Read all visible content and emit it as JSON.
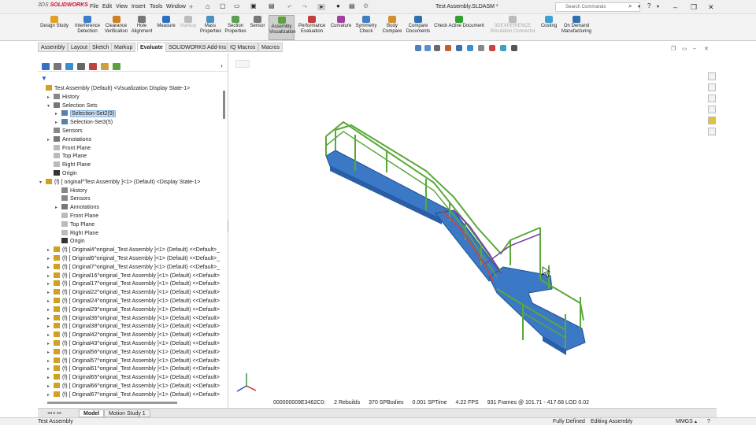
{
  "app": {
    "logo_brand": "3DS",
    "logo_name": "SOLIDWORKS",
    "title": "Test Assembly.SLDASM *",
    "search_placeholder": "Search Commands"
  },
  "menus": [
    "File",
    "Edit",
    "View",
    "Insert",
    "Tools",
    "Window"
  ],
  "ribbon": [
    {
      "label": "Design Study",
      "icon": "design-study-icon",
      "color": "#e0a020"
    },
    {
      "label": "Interference Detection",
      "icon": "interference-icon",
      "color": "#3a7fd0"
    },
    {
      "label": "Clearance Verification",
      "icon": "clearance-icon",
      "color": "#d08020"
    },
    {
      "label": "Hole Alignment",
      "icon": "hole-icon",
      "color": "#777777"
    },
    {
      "label": "Measure",
      "icon": "ruler-icon",
      "color": "#2a70c8"
    },
    {
      "label": "Markup",
      "icon": "markup-icon",
      "color": "#bbbbbb"
    },
    {
      "label": "Mass Properties",
      "icon": "mass-icon",
      "color": "#4a90c0"
    },
    {
      "label": "Section Properties",
      "icon": "section-icon",
      "color": "#5aa050"
    },
    {
      "label": "Sensor",
      "icon": "sensor-icon",
      "color": "#777777"
    },
    {
      "label": "Assembly Visualization",
      "icon": "assembly-viz-icon",
      "color": "#60a040"
    },
    {
      "label": "Performance Evaluation",
      "icon": "performance-icon",
      "color": "#c04040"
    },
    {
      "label": "Curvature",
      "icon": "curvature-icon",
      "color": "#a040a0"
    },
    {
      "label": "Symmetry Check",
      "icon": "symmetry-icon",
      "color": "#4080c0"
    },
    {
      "label": "Body Compare",
      "icon": "body-compare-icon",
      "color": "#d09030"
    },
    {
      "label": "Compare Documents",
      "icon": "compare-docs-icon",
      "color": "#3070b0"
    },
    {
      "label": "Check Active Document",
      "icon": "check-doc-icon",
      "color": "#30a030"
    },
    {
      "label": "3DEXPERIENCE Simulation Connector",
      "icon": "sim-connector-icon",
      "color": "#bbbbbb"
    },
    {
      "label": "Costing",
      "icon": "costing-icon",
      "color": "#40a0d0"
    },
    {
      "label": "On Demand Manufacturing",
      "icon": "manufacturing-icon",
      "color": "#3070b0"
    }
  ],
  "command_tabs": [
    "Assembly",
    "Layout",
    "Sketch",
    "Markup",
    "Evaluate",
    "SOLIDWORKS Add-Ins",
    "IQ Macros",
    "Macros"
  ],
  "active_command_tab": "Evaluate",
  "tree": [
    {
      "label": "Test Assembly (Default) <Visualization Display State-1>",
      "level": 0,
      "toggle": "",
      "icon": "assembly-icon"
    },
    {
      "label": "History",
      "level": 1,
      "toggle": "▸",
      "icon": "history-icon"
    },
    {
      "label": "Selection Sets",
      "level": 1,
      "toggle": "▾",
      "icon": "selection-sets-icon"
    },
    {
      "label": "Selection-Set2(9)",
      "level": 2,
      "toggle": "▸",
      "icon": "selection-set-icon",
      "selected": true
    },
    {
      "label": "Selection-Set3(5)",
      "level": 2,
      "toggle": "▸",
      "icon": "selection-set-icon"
    },
    {
      "label": "Sensors",
      "level": 1,
      "toggle": "",
      "icon": "sensor-folder-icon"
    },
    {
      "label": "Annotations",
      "level": 1,
      "toggle": "▸",
      "icon": "annotations-icon"
    },
    {
      "label": "Front Plane",
      "level": 1,
      "toggle": "",
      "icon": "plane-icon"
    },
    {
      "label": "Top Plane",
      "level": 1,
      "toggle": "",
      "icon": "plane-icon"
    },
    {
      "label": "Right Plane",
      "level": 1,
      "toggle": "",
      "icon": "plane-icon"
    },
    {
      "label": "Origin",
      "level": 1,
      "toggle": "",
      "icon": "origin-icon"
    },
    {
      "label": "(f) [ original^Test Assembly ]<1> (Default) <Display State-1>",
      "level": 0,
      "toggle": "▾",
      "icon": "subassembly-icon"
    },
    {
      "label": "History",
      "level": 2,
      "toggle": "",
      "icon": "history-icon"
    },
    {
      "label": "Sensors",
      "level": 2,
      "toggle": "",
      "icon": "sensor-folder-icon"
    },
    {
      "label": "Annotations",
      "level": 2,
      "toggle": "▸",
      "icon": "annotations-icon"
    },
    {
      "label": "Front Plane",
      "level": 2,
      "toggle": "",
      "icon": "plane-icon"
    },
    {
      "label": "Top Plane",
      "level": 2,
      "toggle": "",
      "icon": "plane-icon"
    },
    {
      "label": "Right Plane",
      "level": 2,
      "toggle": "",
      "icon": "plane-icon"
    },
    {
      "label": "Origin",
      "level": 2,
      "toggle": "",
      "icon": "origin-icon"
    },
    {
      "label": "(f) [ Original4^original_Test Assembly ]<1> (Default) <<Default>_",
      "level": 1,
      "toggle": "▸",
      "icon": "subassembly-icon"
    },
    {
      "label": "(f) [ Original6^original_Test Assembly ]<1> (Default) <<Default>_",
      "level": 1,
      "toggle": "▸",
      "icon": "subassembly-icon"
    },
    {
      "label": "(f) [ Original7^original_Test Assembly ]<1> (Default) <<Default>_",
      "level": 1,
      "toggle": "▸",
      "icon": "subassembly-icon"
    },
    {
      "label": "(f) [ Original16^original_Test Assembly ]<1> (Default) <<Default>",
      "level": 1,
      "toggle": "▸",
      "icon": "subassembly-icon"
    },
    {
      "label": "(f) [ Original17^original_Test Assembly ]<1> (Default) <<Default>",
      "level": 1,
      "toggle": "▸",
      "icon": "subassembly-icon"
    },
    {
      "label": "(f) [ Original22^original_Test Assembly ]<1> (Default) <<Default>",
      "level": 1,
      "toggle": "▸",
      "icon": "subassembly-icon"
    },
    {
      "label": "(f) [ Original24^original_Test Assembly ]<1> (Default) <<Default>",
      "level": 1,
      "toggle": "▸",
      "icon": "subassembly-icon"
    },
    {
      "label": "(f) [ Original29^original_Test Assembly ]<1> (Default) <<Default>",
      "level": 1,
      "toggle": "▸",
      "icon": "subassembly-icon"
    },
    {
      "label": "(f) [ Original36^original_Test Assembly ]<1> (Default) <<Default>",
      "level": 1,
      "toggle": "▸",
      "icon": "subassembly-icon"
    },
    {
      "label": "(f) [ Original38^original_Test Assembly ]<1> (Default) <<Default>",
      "level": 1,
      "toggle": "▸",
      "icon": "subassembly-icon"
    },
    {
      "label": "(f) [ Original42^original_Test Assembly ]<1> (Default) <<Default>",
      "level": 1,
      "toggle": "▸",
      "icon": "subassembly-icon"
    },
    {
      "label": "(f) [ Original43^original_Test Assembly ]<1> (Default) <<Default>",
      "level": 1,
      "toggle": "▸",
      "icon": "subassembly-icon"
    },
    {
      "label": "(f) [ Original56^original_Test Assembly ]<1> (Default) <<Default>",
      "level": 1,
      "toggle": "▸",
      "icon": "subassembly-icon"
    },
    {
      "label": "(f) [ Original57^original_Test Assembly ]<1> (Default) <<Default>",
      "level": 1,
      "toggle": "▸",
      "icon": "subassembly-icon"
    },
    {
      "label": "(f) [ Original61^original_Test Assembly ]<1> (Default) <<Default>",
      "level": 1,
      "toggle": "▸",
      "icon": "subassembly-icon"
    },
    {
      "label": "(f) [ Original65^original_Test Assembly ]<1> (Default) <<Default>",
      "level": 1,
      "toggle": "▸",
      "icon": "subassembly-icon"
    },
    {
      "label": "(f) [ Original66^original_Test Assembly ]<1> (Default) <<Default>",
      "level": 1,
      "toggle": "▸",
      "icon": "subassembly-icon"
    },
    {
      "label": "(f) [ Original67^original_Test Assembly ]<1> (Default) <<Default>",
      "level": 1,
      "toggle": "▸",
      "icon": "subassembly-icon"
    }
  ],
  "stats": {
    "id": "000000009E3462C0:",
    "rebuilds": "2 Rebuilds",
    "bodies": "370 SPBodies",
    "sptime": "0.001 SPTime",
    "fps": "4.22 FPS",
    "frames": "931 Frames @ 101.71 - 417.68 LOD 0.02"
  },
  "bottom_tabs": [
    "Model",
    "Motion Study 1"
  ],
  "active_bottom_tab": "Model",
  "status": {
    "left": "Test Assembly",
    "fully_defined": "Fully Defined",
    "editing": "Editing Assembly",
    "units": "MMGS"
  },
  "colors": {
    "plate": "#3b78c6",
    "rail_green": "#5aa83a",
    "rail_red": "#c84a3a",
    "rail_purple": "#7a3fa8",
    "accent_red": "#c8102e"
  }
}
